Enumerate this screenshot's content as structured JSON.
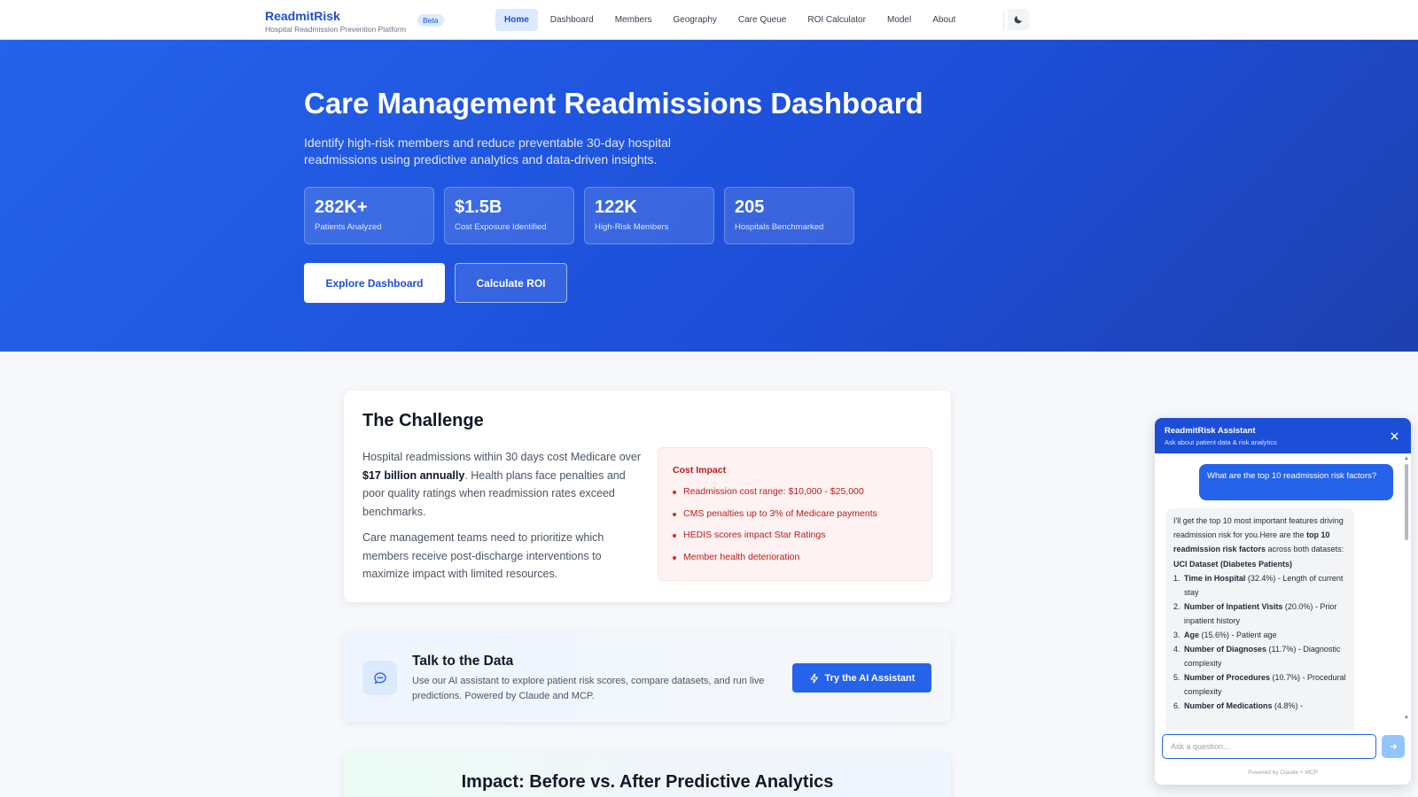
{
  "nav": {
    "brand": "ReadmitRisk",
    "subtitle": "Hospital Readmission Prevention Platform",
    "badge": "Beta",
    "links": [
      "Home",
      "Dashboard",
      "Members",
      "Geography",
      "Care Queue",
      "ROI Calculator",
      "Model",
      "About"
    ],
    "active_link": "Home",
    "theme_icon": "moon-icon"
  },
  "hero": {
    "title": "Care Management Readmissions Dashboard",
    "description": "Identify high-risk members and reduce preventable 30-day hospital readmissions using predictive analytics and data-driven insights.",
    "stats": [
      {
        "value": "282K+",
        "label": "Patients Analyzed"
      },
      {
        "value": "$1.5B",
        "label": "Cost Exposure Identified"
      },
      {
        "value": "122K",
        "label": "High-Risk Members"
      },
      {
        "value": "205",
        "label": "Hospitals Benchmarked"
      }
    ],
    "primary_button": "Explore Dashboard",
    "secondary_button": "Calculate ROI"
  },
  "challenge": {
    "title": "The Challenge",
    "p1_before": "Hospital readmissions within 30 days cost Medicare over ",
    "p1_bold": "$17 billion annually",
    "p1_after": ". Health plans face penalties and poor quality ratings when readmission rates exceed benchmarks.",
    "p2": "Care management teams need to prioritize which members receive post-discharge interventions to maximize impact with limited resources.",
    "cost_title": "Cost Impact",
    "cost_items": [
      "Readmission cost range: $10,000 - $25,000",
      "CMS penalties up to 3% of Medicare payments",
      "HEDIS scores impact Star Ratings",
      "Member health deterioration"
    ]
  },
  "talk": {
    "title": "Talk to the Data",
    "description": "Use our AI assistant to explore patient risk scores, compare datasets, and run live predictions. Powered by Claude and MCP.",
    "button": "Try the AI Assistant",
    "icon": "chat-bubble-icon"
  },
  "impact": {
    "title": "Impact: Before vs. After Predictive Analytics"
  },
  "chat": {
    "title": "ReadmitRisk Assistant",
    "subtitle": "Ask about patient data & risk analytics",
    "user_message": "What are the top 10 readmission risk factors?",
    "bot_intro_1": "I'll get the top 10 most important features driving readmission risk for you.Here are the ",
    "bot_intro_bold": "top 10 readmission risk factors",
    "bot_intro_2": " across both datasets:",
    "bot_heading": "UCI Dataset (Diabetes Patients)",
    "factors": [
      {
        "num": "1.",
        "name": "Time in Hospital",
        "rest": " (32.4%) - Length of current stay"
      },
      {
        "num": "2.",
        "name": "Number of Inpatient Visits",
        "rest": " (20.0%) - Prior inpatient history"
      },
      {
        "num": "3.",
        "name": "Age",
        "rest": " (15.6%) - Patient age"
      },
      {
        "num": "4.",
        "name": "Number of Diagnoses",
        "rest": " (11.7%) - Diagnostic complexity"
      },
      {
        "num": "5.",
        "name": "Number of Procedures",
        "rest": " (10.7%) - Procedural complexity"
      },
      {
        "num": "6.",
        "name": "Number of Medications",
        "rest": " (4.8%) -"
      }
    ],
    "input_placeholder": "Ask a question...",
    "footer": "Powered by Claude + MCP"
  }
}
